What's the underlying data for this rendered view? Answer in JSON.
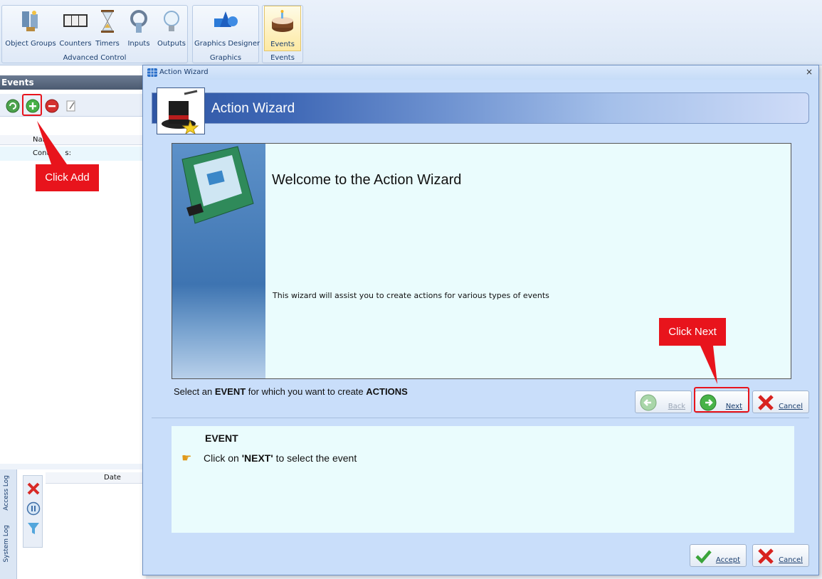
{
  "ribbon": {
    "groups": [
      {
        "label": "Advanced Control",
        "buttons": [
          "Object Groups",
          "Counters",
          "Timers",
          "Inputs",
          "Outputs"
        ]
      },
      {
        "label": "Graphics",
        "buttons": [
          "Graphics Designer"
        ]
      },
      {
        "label": "Events",
        "buttons": [
          "Events"
        ]
      }
    ]
  },
  "events_pane": {
    "title": "Events",
    "column_header": "Nam",
    "row_text": "Conta     s:"
  },
  "log_area": {
    "tabs": [
      "Access Log",
      "System Log"
    ],
    "date_header": "Date"
  },
  "dialog": {
    "window_title": "Action Wizard",
    "close_glyph": "×",
    "banner_title": "Action Wizard",
    "welcome_heading": "Welcome to the Action Wizard",
    "welcome_text": "This wizard will assist you to create actions for various types of events",
    "prompt_pre": "Select an ",
    "prompt_event": "EVENT",
    "prompt_mid": " for which you want to create ",
    "prompt_actions": "ACTIONS",
    "buttons": {
      "back": "Back",
      "next": "Next",
      "cancel": "Cancel",
      "accept": "Accept",
      "cancel2": "Cancel"
    },
    "info_heading": "EVENT",
    "info_text_pre": "Click on ",
    "info_text_bold": "'NEXT'",
    "info_text_post": " to select the event"
  },
  "callouts": {
    "add": "Click Add",
    "next": "Click Next"
  },
  "colors": {
    "callout_red": "#e8141c",
    "dialog_bg": "#c9defa",
    "panel_bg": "#eafcfd"
  }
}
